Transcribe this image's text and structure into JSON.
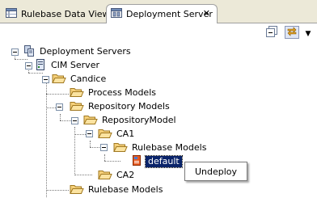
{
  "tabs": [
    {
      "label": "Rulebase Data View",
      "icon": "rulebase-view-icon",
      "active": false
    },
    {
      "label": "Deployment Server",
      "icon": "deployment-server-view-icon",
      "active": true,
      "close_glyph": "✕"
    }
  ],
  "toolbar": {
    "buttons": [
      "collapse-all-icon",
      "link-with-editor-icon",
      "view-menu-icon"
    ],
    "menu_glyph": "▼"
  },
  "tree": {
    "root": "Deployment Servers",
    "server": "CIM Server",
    "project": "Candice",
    "process_models": "Process Models",
    "repository_models": "Repository Models",
    "repository_model": "RepositoryModel",
    "ca1": "CA1",
    "rulebase_models_inner": "Rulebase Models",
    "default_item": "default",
    "ca2": "CA2",
    "rulebase_models": "Rulebase Models"
  },
  "context_menu": {
    "items": [
      "Undeploy"
    ]
  },
  "colors": {
    "selection": "#0a246a",
    "folder": "#f5d07a",
    "chrome": "#ece9d8"
  }
}
